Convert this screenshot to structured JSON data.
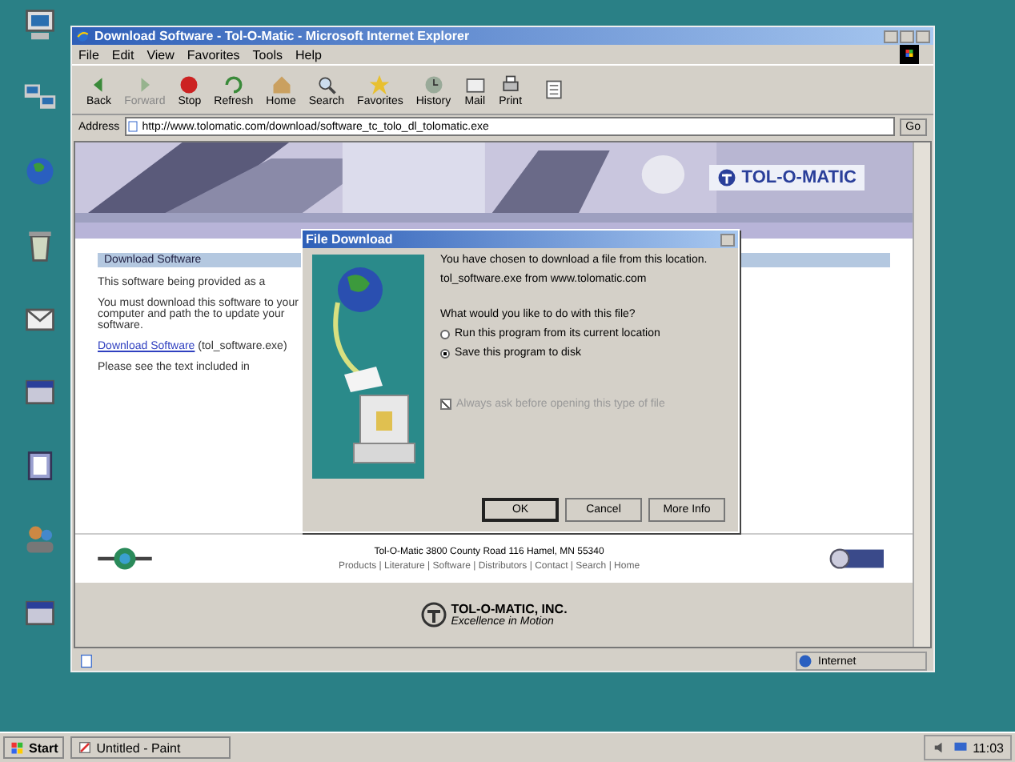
{
  "desktop_icons": [
    {
      "kind": "computer"
    },
    {
      "kind": "network"
    },
    {
      "kind": "globe"
    },
    {
      "kind": "recycle"
    },
    {
      "kind": "mail"
    },
    {
      "kind": "program"
    },
    {
      "kind": "book"
    },
    {
      "kind": "people"
    },
    {
      "kind": "program"
    }
  ],
  "window": {
    "title": "Download Software - Tol-O-Matic - Microsoft Internet Explorer",
    "menu": [
      "File",
      "Edit",
      "View",
      "Favorites",
      "Tools",
      "Help"
    ],
    "toolbar": [
      {
        "label": "Back",
        "disabled": false
      },
      {
        "label": "Forward",
        "disabled": true
      },
      {
        "label": "Stop",
        "disabled": false
      },
      {
        "label": "Refresh",
        "disabled": false
      },
      {
        "label": "Home",
        "disabled": false
      },
      {
        "label": "Search",
        "disabled": false
      },
      {
        "label": "Favorites",
        "disabled": false
      },
      {
        "label": "History",
        "disabled": false
      },
      {
        "label": "Mail",
        "disabled": false
      },
      {
        "label": "Print",
        "disabled": false
      }
    ],
    "address": {
      "label": "Address",
      "value": "http://www.tolomatic.com/download/software_tc_tolo_dl_tolomatic.exe",
      "go": "Go"
    },
    "status_bar": {
      "zone": "Internet"
    }
  },
  "page": {
    "logo": "TOL-O-MATIC",
    "heading": "Download Software",
    "paragraphs": [
      "This software being provided as a",
      "You must download this software to your computer and path the to update your software."
    ],
    "link": "Download Software",
    "link_rest": " (tol_software.exe)",
    "note": "Please see the text included in",
    "footer_address": "Tol-O-Matic 3800 County Road 116 Hamel, MN 55340",
    "footer_links": "Products | Literature | Software | Distributors | Contact | Search | Home",
    "bottom_logo": "TOL-O-MATIC, INC.",
    "bottom_tagline": "Excellence in Motion"
  },
  "dialog": {
    "title": "File Download",
    "intro": "You have chosen to download a file from this location.",
    "file": "tol_software.exe from www.tolomatic.com",
    "question": "What would you like to do with this file?",
    "options": [
      {
        "label": "Run this program from its current location",
        "selected": false
      },
      {
        "label": "Save this program to disk",
        "selected": true
      }
    ],
    "always_ask": {
      "label": "Always ask before opening this type of file",
      "checked": true,
      "disabled": true
    },
    "buttons": [
      "OK",
      "Cancel",
      "More Info"
    ]
  },
  "taskbar": {
    "start": "Start",
    "tasks": [
      {
        "label": "Untitled - Paint",
        "selected": false
      }
    ],
    "clock": "11:03"
  }
}
